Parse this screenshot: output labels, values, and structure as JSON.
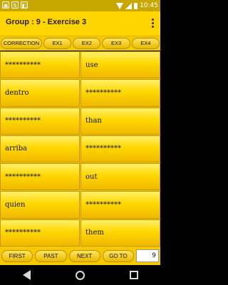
{
  "status": {
    "time": "10:45",
    "left_icons": [
      "image-icon",
      "usb-icon",
      "bag-icon"
    ],
    "right_icons": [
      "wifi-icon",
      "signal-icon",
      "battery-icon"
    ]
  },
  "app": {
    "title": "Group : 9 - Exercise 3"
  },
  "tabs": [
    "CORRECTION",
    "EX1",
    "EX2",
    "EX3",
    "EX4"
  ],
  "rows": [
    [
      "**********",
      "use"
    ],
    [
      "dentro",
      "**********"
    ],
    [
      "**********",
      "than"
    ],
    [
      "arriba",
      "**********"
    ],
    [
      "**********",
      "out"
    ],
    [
      "quien",
      "**********"
    ],
    [
      "**********",
      "them"
    ]
  ],
  "nav": {
    "first": "FIRST",
    "past": "PAST",
    "next": "NEXT",
    "goto": "GO TO",
    "counter": "9"
  },
  "colors": {
    "primary": "#ffd400",
    "status": "#c8a800"
  }
}
